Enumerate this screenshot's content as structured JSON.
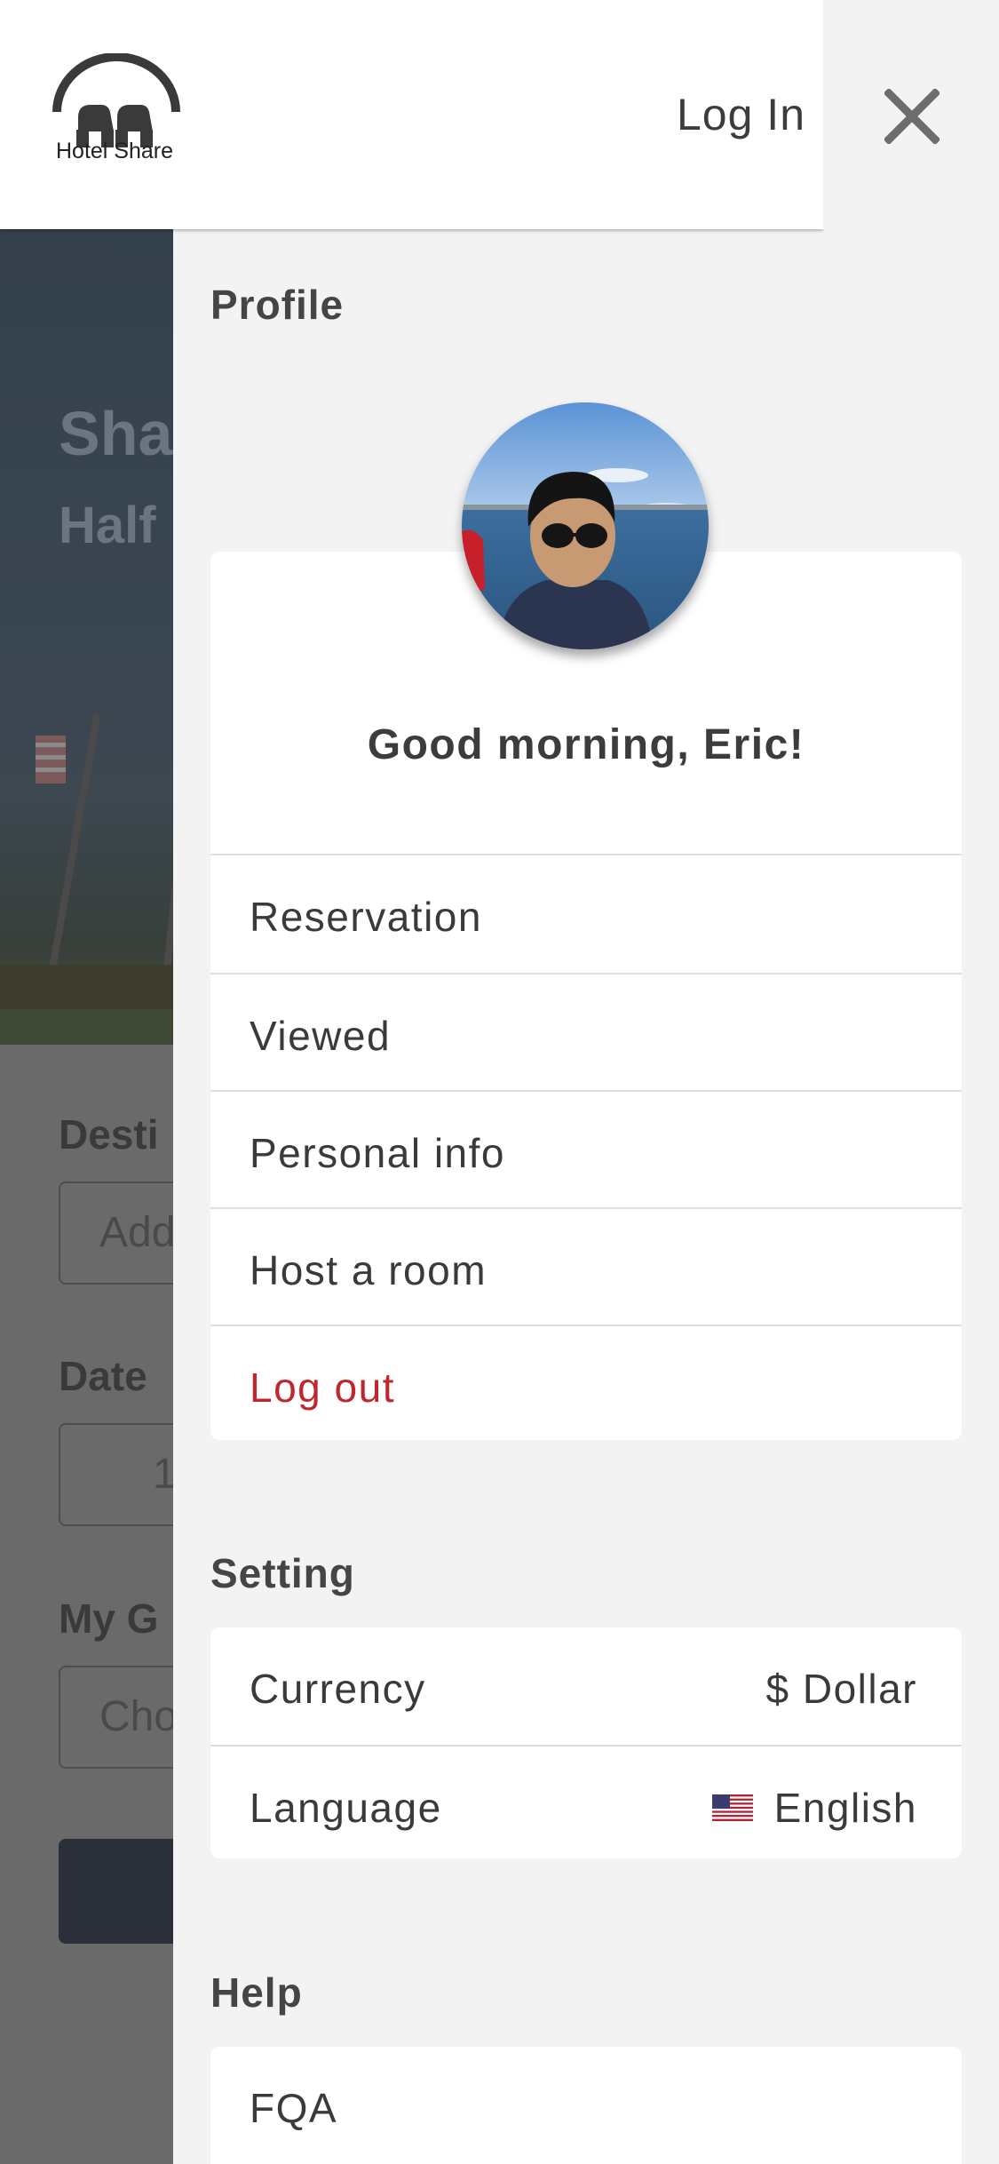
{
  "header": {
    "brand": "Hotel Share",
    "login_label": "Log In",
    "close_icon": "close-icon"
  },
  "background": {
    "hero_title": "Sha",
    "hero_subtitle": "Half",
    "destination_label": "Desti",
    "destination_placeholder": "Add",
    "date_label": "Date",
    "date_value": "1",
    "guests_label": "My G",
    "guests_placeholder": "Cho"
  },
  "drawer": {
    "profile": {
      "title": "Profile",
      "avatar": "avatar-photo",
      "greeting": "Good morning, Eric!",
      "menu": [
        {
          "label": "Reservation"
        },
        {
          "label": "Viewed"
        },
        {
          "label": "Personal info"
        },
        {
          "label": "Host a room"
        },
        {
          "label": "Log out"
        }
      ]
    },
    "settings": {
      "title": "Setting",
      "items": [
        {
          "label": "Currency",
          "value": "$ Dollar"
        },
        {
          "label": "Language",
          "value": "English",
          "icon": "us-flag-icon"
        }
      ]
    },
    "help": {
      "title": "Help",
      "items": [
        {
          "label": "FQA"
        }
      ]
    }
  },
  "colors": {
    "logout": "#c0272d",
    "drawer_bg": "#f3f3f3",
    "card_bg": "#ffffff",
    "overlay": "#6a6a6a"
  }
}
